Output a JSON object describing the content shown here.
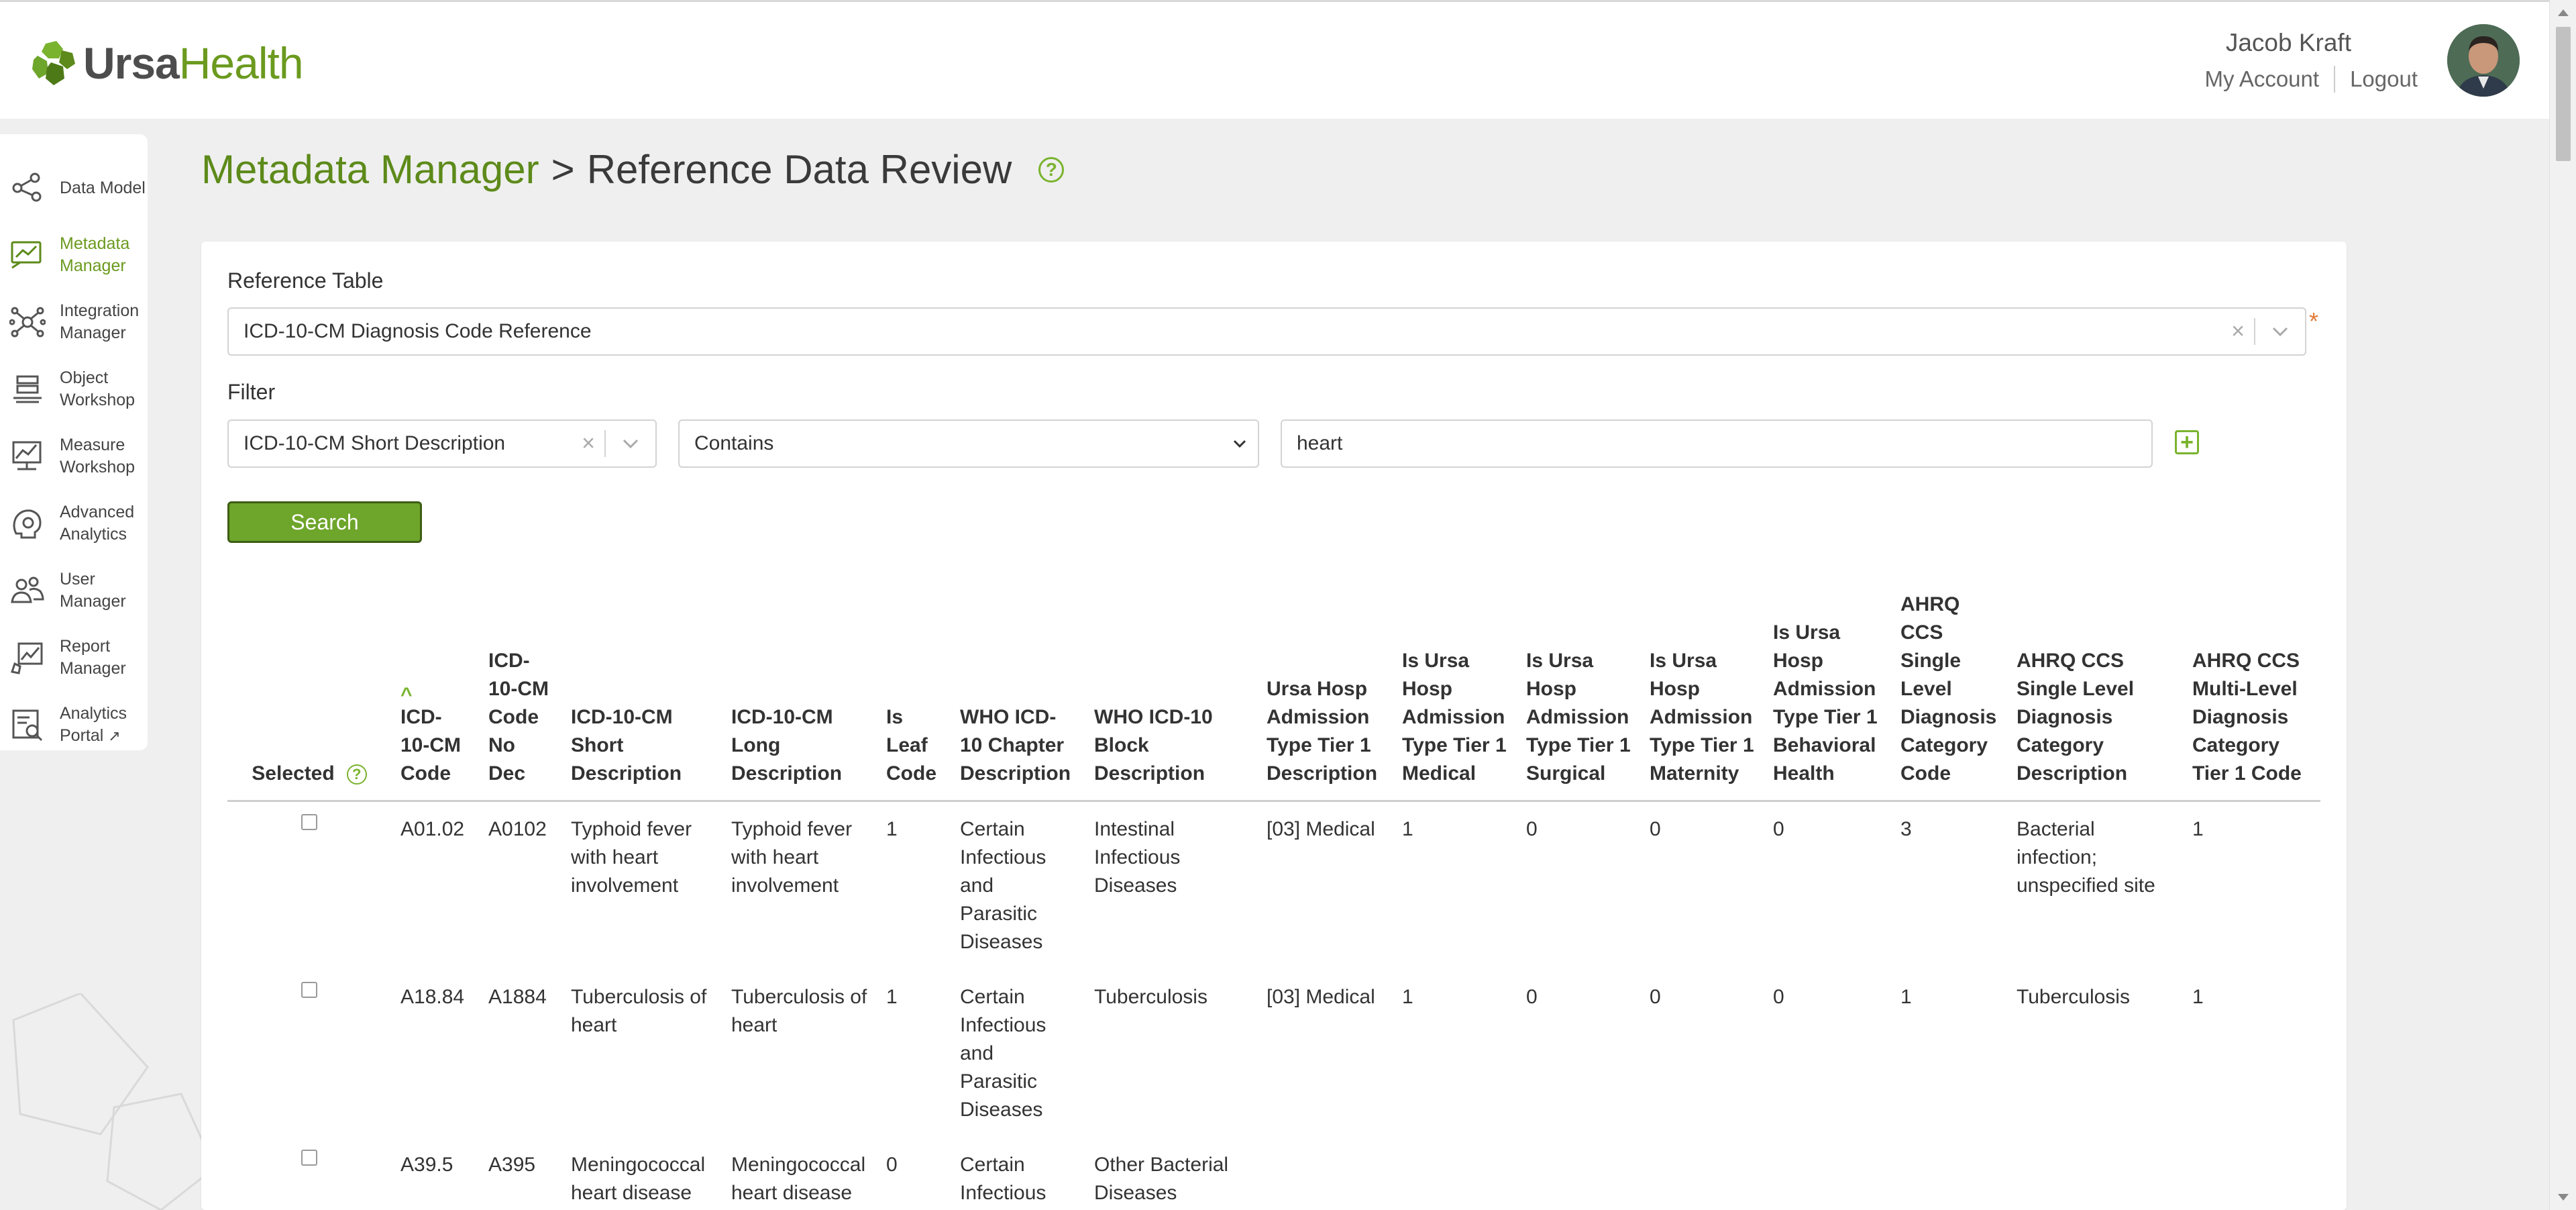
{
  "app": {
    "logo_text_bold": "Ursa",
    "logo_text_light": "Health",
    "accent_color": "#6ea52b",
    "title_color": "#5d8a1a"
  },
  "user": {
    "name": "Jacob Kraft",
    "my_account": "My Account",
    "logout": "Logout"
  },
  "sidebar": {
    "items": [
      {
        "label": "Data Model",
        "icon": "share-nodes-icon",
        "active": false
      },
      {
        "label": "Metadata Manager",
        "icon": "metadata-chart-icon",
        "active": true
      },
      {
        "label": "Integration Manager",
        "icon": "network-icon",
        "active": false
      },
      {
        "label": "Object Workshop",
        "icon": "layers-icon",
        "active": false
      },
      {
        "label": "Measure Workshop",
        "icon": "measure-chart-icon",
        "active": false
      },
      {
        "label": "Advanced Analytics",
        "icon": "brain-gear-icon",
        "active": false
      },
      {
        "label": "User Manager",
        "icon": "users-icon",
        "active": false
      },
      {
        "label": "Report Manager",
        "icon": "report-icon",
        "active": false
      },
      {
        "label": "Analytics Portal",
        "icon": "portal-icon",
        "active": false
      }
    ]
  },
  "page": {
    "breadcrumb_parent": "Metadata Manager",
    "breadcrumb_sep": ">",
    "breadcrumb_current": "Reference Data Review",
    "help_glyph": "?"
  },
  "form": {
    "reference_table_label": "Reference Table",
    "reference_table_value": "ICD-10-CM Diagnosis Code Reference",
    "required_mark": "*",
    "filter_label": "Filter",
    "filter_field_value": "ICD-10-CM Short Description",
    "filter_operator_value": "Contains",
    "filter_text_value": "heart",
    "add_filter_glyph": "+",
    "search_label": "Search"
  },
  "table": {
    "columns": [
      "Selected",
      "ICD-10-CM Code",
      "ICD-10-CM Code No Dec",
      "ICD-10-CM Short Description",
      "ICD-10-CM Long Description",
      "Is Leaf Code",
      "WHO ICD-10 Chapter Description",
      "WHO ICD-10 Block Description",
      "Ursa Hosp Admission Type Tier 1 Description",
      "Is Ursa Hosp Admission Type Tier 1 Medical",
      "Is Ursa Hosp Admission Type Tier 1 Surgical",
      "Is Ursa Hosp Admission Type Tier 1 Maternity",
      "Is Ursa Hosp Admission Type Tier 1 Behavioral Health",
      "AHRQ CCS Single Level Diagnosis Category Code",
      "AHRQ CCS Single Level Diagnosis Category Description",
      "AHRQ CCS Multi-Level Diagnosis Category Tier 1 Code"
    ],
    "rows": [
      [
        "A01.02",
        "A0102",
        "Typhoid fever with heart involvement",
        "Typhoid fever with heart involvement",
        "1",
        "Certain Infectious and Parasitic Diseases",
        "Intestinal Infectious Diseases",
        "[03] Medical",
        "1",
        "0",
        "0",
        "0",
        "3",
        "Bacterial infection; unspecified site",
        "1"
      ],
      [
        "A18.84",
        "A1884",
        "Tuberculosis of heart",
        "Tuberculosis of heart",
        "1",
        "Certain Infectious and Parasitic Diseases",
        "Tuberculosis",
        "[03] Medical",
        "1",
        "0",
        "0",
        "0",
        "1",
        "Tuberculosis",
        "1"
      ],
      [
        "A39.5",
        "A395",
        "Meningococcal heart disease",
        "Meningococcal heart disease",
        "0",
        "Certain Infectious",
        "Other Bacterial Diseases",
        "",
        "",
        "",
        "",
        "",
        "",
        "",
        ""
      ]
    ]
  }
}
